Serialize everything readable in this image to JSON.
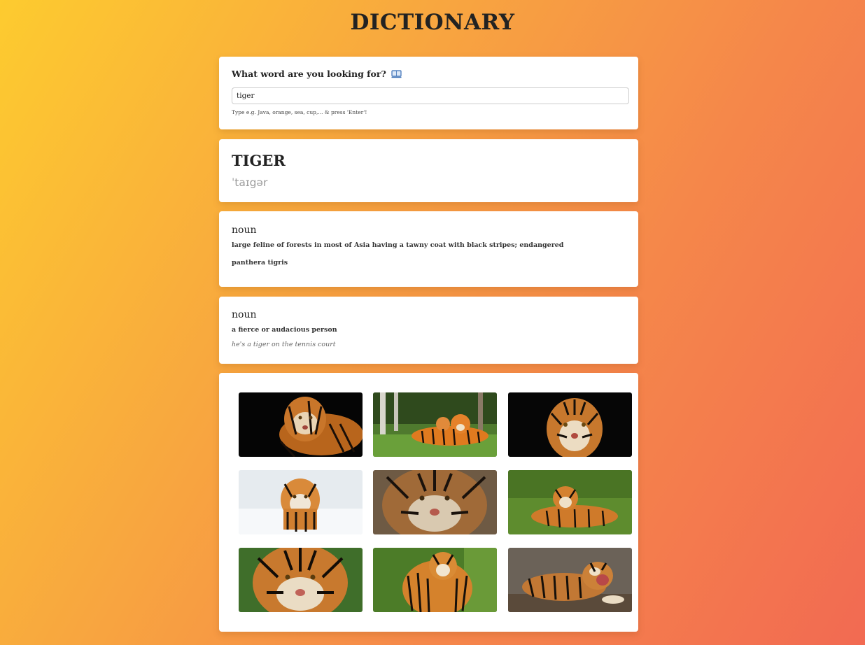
{
  "app": {
    "title": "DICTIONARY"
  },
  "search": {
    "label": "What word are you looking for?",
    "value": "tiger",
    "hint": "Type e.g. Java, orange, sea, cup,... & press 'Enter'!"
  },
  "result": {
    "word": "TIGER",
    "phonetic": "ˈtaɪgər"
  },
  "meanings": [
    {
      "part_of_speech": "noun",
      "definition": "large feline of forests in most of Asia having a tawny coat with black stripes; endangered",
      "synonym": "panthera tigris"
    },
    {
      "part_of_speech": "noun",
      "definition": "a fierce or audacious person",
      "example": "he's a tiger on the tennis court"
    }
  ],
  "photos": [
    {
      "icon": "tiger-photo-dark-background"
    },
    {
      "icon": "tiger-photo-with-cubs-in-forest"
    },
    {
      "icon": "tiger-photo-face-dark-background"
    },
    {
      "icon": "tiger-photo-in-snow"
    },
    {
      "icon": "tiger-photo-closeup-face"
    },
    {
      "icon": "tiger-photo-lying-on-grass"
    },
    {
      "icon": "tiger-photo-face-on-grass"
    },
    {
      "icon": "tiger-photo-standing-on-grass"
    },
    {
      "icon": "tiger-photo-roaring-on-log"
    }
  ],
  "colors": {
    "background_start": "#fdcb2f",
    "background_end": "#f26a52",
    "card": "#ffffff",
    "phonetic": "#9a9a9a"
  }
}
